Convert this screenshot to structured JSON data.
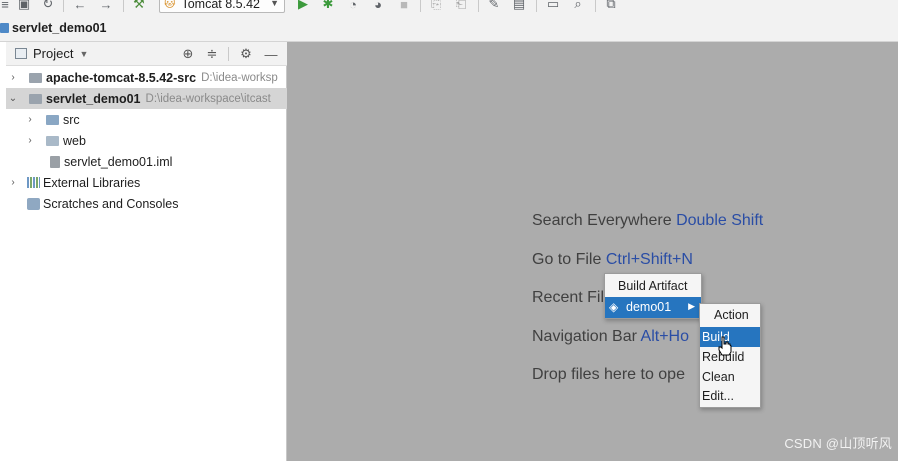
{
  "toolbar": {
    "run_config": "Tomcat 8.5.42",
    "icons": [
      "save-all-icon",
      "sync-icon",
      "back-icon",
      "forward-icon",
      "build-hammer-icon",
      "run-icon",
      "debug-icon",
      "coverage-icon",
      "profile-icon",
      "stop-icon",
      "attach-icon",
      "tools-wrench-icon",
      "project-structure-icon",
      "terminal-icon",
      "search-icon",
      "vcs-icon"
    ]
  },
  "navbar": {
    "crumb": "servlet_demo01"
  },
  "panel": {
    "title": "Project",
    "tree": [
      {
        "label": "apache-tomcat-8.5.42-src",
        "path": "D:\\idea-worksp"
      },
      {
        "label": "servlet_demo01",
        "path": "D:\\idea-workspace\\itcast"
      },
      {
        "label": "src"
      },
      {
        "label": "web"
      },
      {
        "label": "servlet_demo01.iml"
      },
      {
        "label": "External Libraries"
      },
      {
        "label": "Scratches and Consoles"
      }
    ]
  },
  "editor": {
    "hints": [
      {
        "text": "Search Everywhere",
        "key": "Double Shift"
      },
      {
        "text": "Go to File",
        "key": "Ctrl+Shift+N"
      },
      {
        "text": "Recent Fil",
        "key": ""
      },
      {
        "text": "Navigation Bar",
        "key": "Alt+Ho"
      },
      {
        "text": "Drop files here to ope",
        "key": ""
      }
    ]
  },
  "build_artifact_popup": {
    "title": "Build Artifact",
    "artifact": "demo01"
  },
  "action_popup": {
    "title": "Action",
    "items": [
      "Build",
      "Rebuild",
      "Clean",
      "Edit..."
    ]
  },
  "watermark": "CSDN @山顶听风",
  "colors": {
    "selection": "#2675bf",
    "editor_background": "#acacac",
    "shortcut_text": "#2a4da5"
  }
}
